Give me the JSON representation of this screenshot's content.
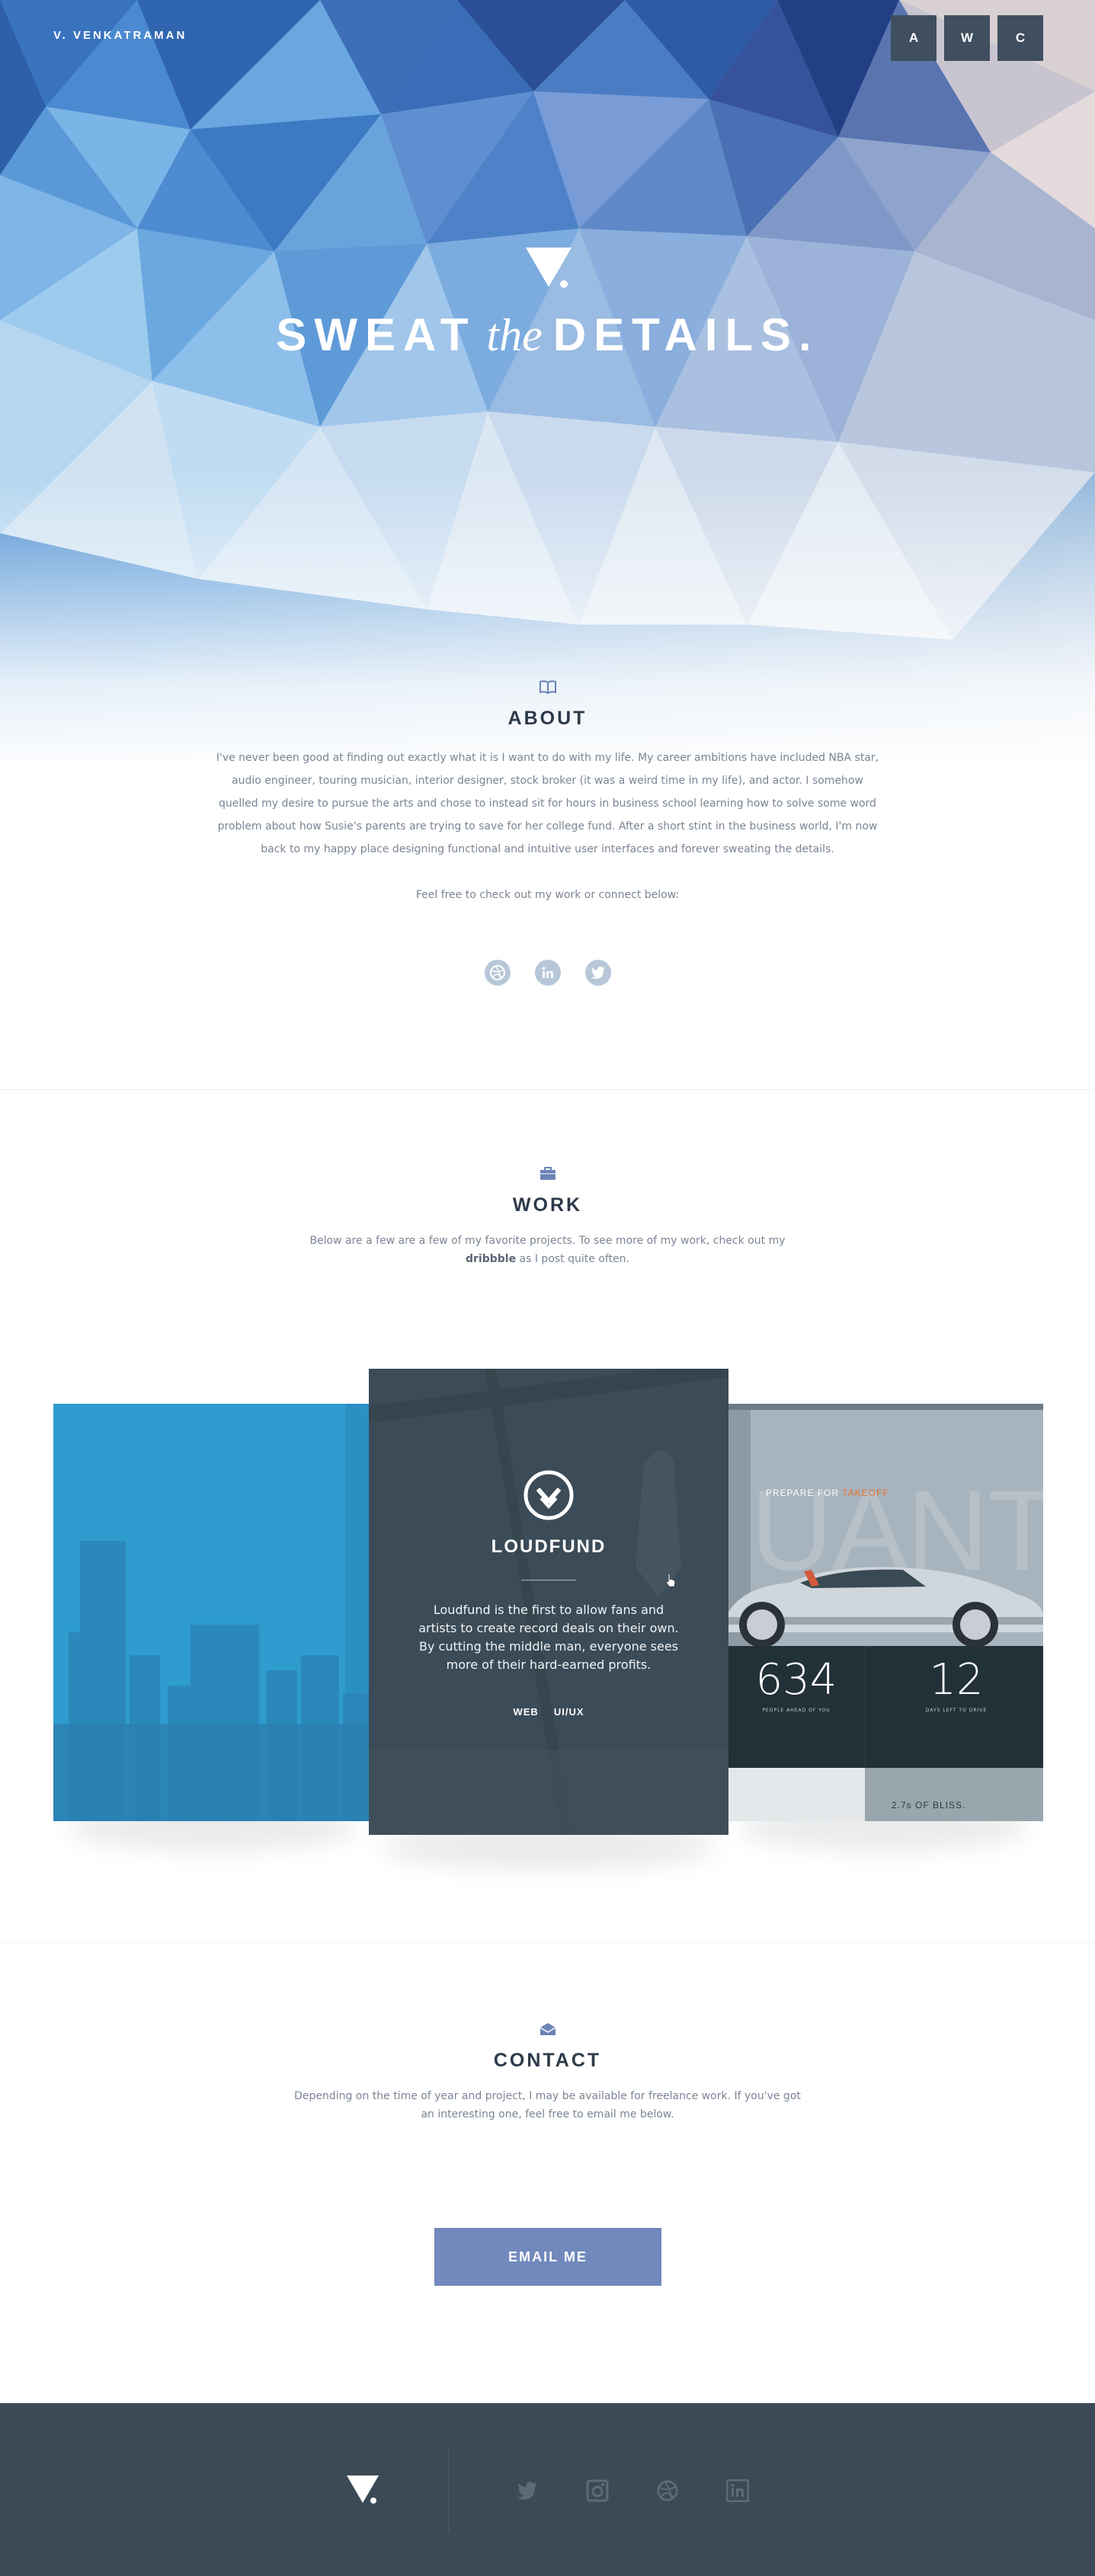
{
  "header": {
    "brand": "V. VENKATRAMAN",
    "nav": [
      "A",
      "W",
      "C"
    ]
  },
  "hero": {
    "title_left": "SWEAT",
    "title_mid": "the",
    "title_right": "DETAILS."
  },
  "about": {
    "title": "ABOUT",
    "lines": [
      "I've never been good at finding out exactly what it is I want to do with my life. My career ambitions have included NBA star,",
      "audio engineer, touring musician, interior designer, stock broker (it was a weird time in my life), and actor. I somehow",
      "quelled my desire to pursue the arts and chose to instead sit for hours in business school learning how to solve some word",
      "problem about how Susie's parents are trying to save for her college fund. After a short stint in the business world, I'm now",
      "back to my happy place designing functional and intuitive user interfaces and forever sweating the details."
    ],
    "cta": "Feel free to check out my work or connect below:",
    "social": [
      "dribbble-icon",
      "linkedin-icon",
      "twitter-icon"
    ]
  },
  "work": {
    "title": "WORK",
    "line1": "Below are a few are a few of my favorite projects. To see more of my work, check out my",
    "line2_link": "dribbble",
    "line2_rest": " as I post quite often.",
    "featured": {
      "title": "LOUDFUND",
      "desc": "Loudfund is the first to allow fans and artists to create record deals on their own. By cutting the middle man, everyone sees more of their hard-earned profits.",
      "tags": [
        "WEB",
        "UI/UX"
      ]
    },
    "right_card": {
      "prepare_a": "PREPARE FOR ",
      "prepare_b": "TAKEOFF",
      "big": "UANT",
      "stat1": "634",
      "stat1_label": "PEOPLE AHEAD OF YOU",
      "stat2": "12",
      "stat2_label": "DAYS LEFT TO DRIVE",
      "bliss": "2.7s OF BLISS."
    }
  },
  "contact": {
    "title": "CONTACT",
    "line1": "Depending on the time of year and project, I may be available for freelance work. If you've got",
    "line2": "an interesting one, feel free to email me below.",
    "button": "EMAIL ME"
  },
  "footer": {
    "social": [
      "twitter-icon",
      "instagram-icon",
      "dribbble-icon",
      "linkedin-icon"
    ]
  },
  "colors": {
    "accent": "#7189bd",
    "dark": "#3b4a56",
    "nav_bg": "#3f4f5f",
    "left_card": "#2e9ccf"
  }
}
